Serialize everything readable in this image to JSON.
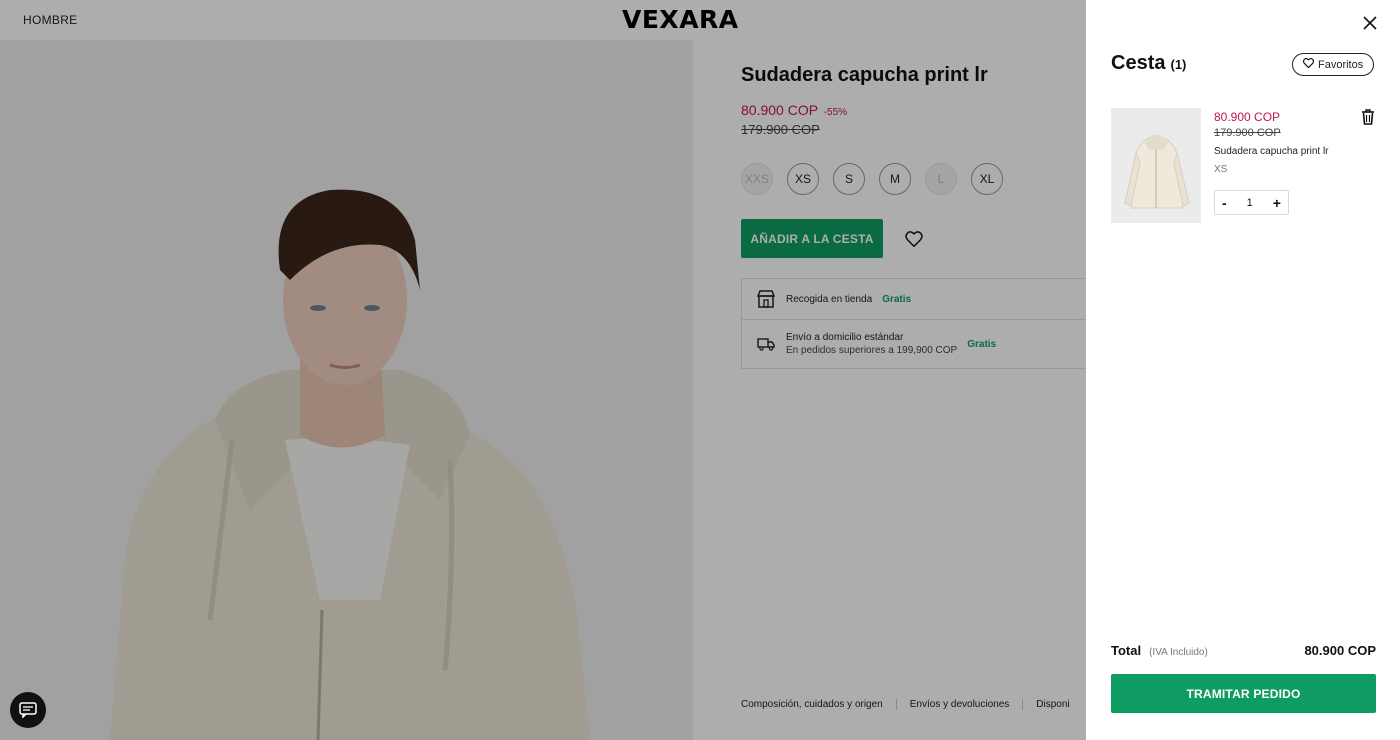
{
  "header": {
    "nav_label": "HOMBRE",
    "logo": "VEXARA"
  },
  "product": {
    "title": "Sudadera capucha print lr",
    "price": "80.900 COP",
    "discount": "-55%",
    "old_price": "179.900 COP",
    "sizes": [
      {
        "label": "XXS",
        "available": false
      },
      {
        "label": "XS",
        "available": true
      },
      {
        "label": "S",
        "available": true
      },
      {
        "label": "M",
        "available": true
      },
      {
        "label": "L",
        "available": false
      },
      {
        "label": "XL",
        "available": true
      }
    ],
    "add_to_cart_label": "AÑADIR A LA CESTA",
    "delivery": {
      "pickup_label": "Recogida en tienda",
      "pickup_price": "Gratis",
      "home_label": "Envío a domicilio estándar",
      "home_sub": "En pedidos superiores a 199,900 COP",
      "home_price": "Gratis"
    },
    "footer_links": [
      "Composición, cuidados y origen",
      "Envíos y devoluciones",
      "Disponi"
    ]
  },
  "cart": {
    "title": "Cesta",
    "count": "(1)",
    "favorites_label": "Favoritos",
    "items": [
      {
        "price": "80.900 COP",
        "old_price": "179.900 COP",
        "name": "Sudadera capucha print lr",
        "size": "XS",
        "quantity": "1"
      }
    ],
    "total_label": "Total",
    "total_note": "(IVA Incluido)",
    "total_value": "80.900 COP",
    "checkout_label": "TRAMITAR PEDIDO"
  },
  "colors": {
    "accent_green": "#0f9c62",
    "sale_red": "#c1174a"
  }
}
